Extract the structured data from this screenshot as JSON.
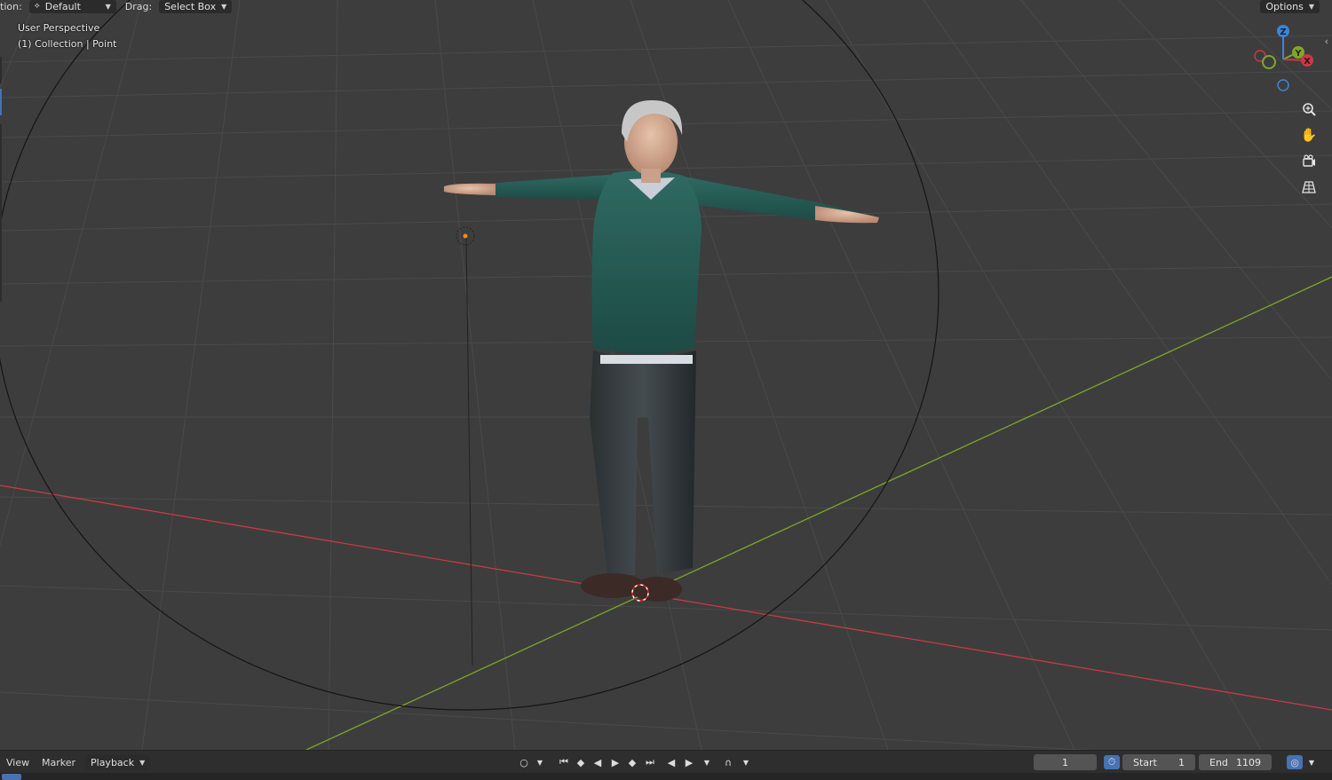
{
  "header": {
    "orientation_label": "tion:",
    "transform_orientation": "Default",
    "drag_label": "Drag:",
    "drag_value": "Select Box",
    "options_label": "Options"
  },
  "viewport": {
    "perspective_label": "User Perspective",
    "collection_label": "(1) Collection | Point"
  },
  "gizmo": {
    "z": "Z",
    "y": "Y",
    "x": "X"
  },
  "nav_icons": [
    "zoom-icon",
    "hand-pan-icon",
    "camera-view-icon",
    "grid-ortho-icon"
  ],
  "timeline": {
    "menu_view": "View",
    "menu_marker": "Marker",
    "menu_playback": "Playback",
    "current_frame": "1",
    "start_label": "Start",
    "start_value": "1",
    "end_label": "End",
    "end_value": "1109"
  },
  "colors": {
    "x_axis": "#c93a45",
    "y_axis": "#7ea72b",
    "z_axis": "#3f84d6",
    "viewport_bg": "#3d3d3d"
  }
}
